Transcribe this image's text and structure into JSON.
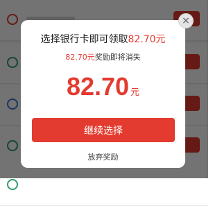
{
  "colors": {
    "accent": "#e33b2f",
    "overlay": "rgba(0,0,0,0.55)"
  },
  "modal": {
    "title_prefix": "选择银行卡即可领取",
    "title_amount": "82.70元",
    "subtitle_amount": "82.70元",
    "subtitle_suffix": "奖励即将消失",
    "amount_value": "82.70",
    "amount_unit": "元",
    "continue_label": "继续选择",
    "give_up_label": "放弃奖励",
    "close_icon": "×"
  }
}
